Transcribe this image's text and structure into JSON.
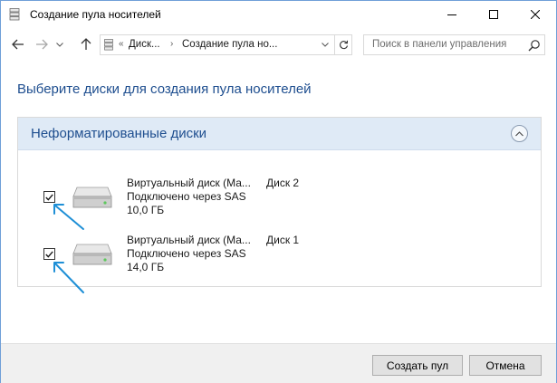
{
  "window": {
    "title": "Создание пула носителей"
  },
  "nav": {
    "breadcrumb": [
      "Диск...",
      "Создание пула но..."
    ],
    "overflow": "«",
    "separator": "›",
    "search_placeholder": "Поиск в панели управления"
  },
  "page": {
    "heading": "Выберите диски для создания пула носителей"
  },
  "group": {
    "title": "Неформатированные диски",
    "disks": [
      {
        "name": "Виртуальный диск (Ма...",
        "connection": "Подключено через SAS",
        "size": "10,0 ГБ",
        "label": "Диск 2",
        "checked": true
      },
      {
        "name": "Виртуальный диск (Ма...",
        "connection": "Подключено через SAS",
        "size": "14,0 ГБ",
        "label": "Диск 1",
        "checked": true
      }
    ]
  },
  "footer": {
    "create_label": "Создать пул",
    "cancel_label": "Отмена"
  },
  "icons": {
    "title": "storage-spaces-icon",
    "minimize": "minimize-icon",
    "maximize": "maximize-icon",
    "close": "close-icon",
    "back": "back-arrow-icon",
    "forward": "forward-arrow-icon",
    "recent": "chevron-down-icon",
    "up": "up-arrow-icon",
    "refresh": "refresh-icon",
    "search": "search-icon",
    "collapse": "chevron-up-icon",
    "drive": "hard-drive-icon",
    "annotation": "annotation-arrow-icon"
  },
  "colors": {
    "accent_text": "#1e4e8f",
    "group_header_bg": "#dfeaf6",
    "annotation": "#1e8fd6"
  }
}
